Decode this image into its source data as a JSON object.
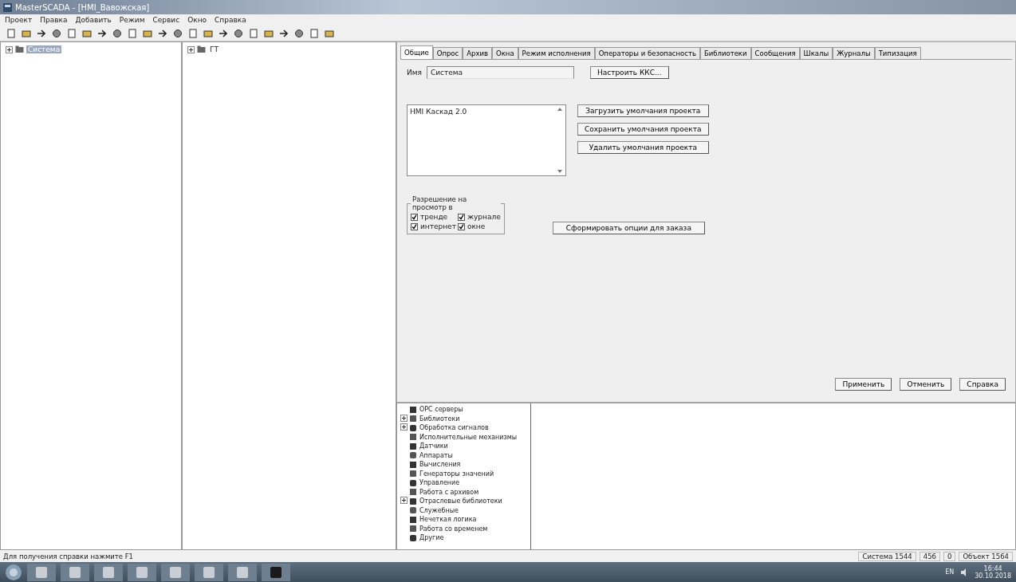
{
  "window": {
    "title": "MasterSCADA - [HMI_Вавожская]"
  },
  "menu": [
    "Проект",
    "Правка",
    "Добавить",
    "Режим",
    "Сервис",
    "Окно",
    "Справка"
  ],
  "system_tree": [
    {
      "label": "Система",
      "selected": true,
      "expanded": false
    }
  ],
  "object_tree": [
    {
      "label": "ГТ",
      "selected": false,
      "expanded": false
    }
  ],
  "tabs": [
    {
      "label": "Общие",
      "selected": true
    },
    {
      "label": "Опрос",
      "selected": false
    },
    {
      "label": "Архив",
      "selected": false
    },
    {
      "label": "Окна",
      "selected": false
    },
    {
      "label": "Режим исполнения",
      "selected": false
    },
    {
      "label": "Операторы и безопасность",
      "selected": false
    },
    {
      "label": "Библиотеки",
      "selected": false
    },
    {
      "label": "Сообщения",
      "selected": false
    },
    {
      "label": "Шкалы",
      "selected": false
    },
    {
      "label": "Журналы",
      "selected": false
    },
    {
      "label": "Типизация",
      "selected": false
    }
  ],
  "general": {
    "name_label": "Имя",
    "name_value": "Система",
    "kks_button": "Настроить ККС...",
    "description": "HMI Каскад 2.0",
    "default_buttons": [
      "Загрузить умолчания проекта",
      "Сохранить умолчания проекта",
      "Удалить умолчания проекта"
    ],
    "view_group": {
      "title": "Разрешение на просмотр в",
      "options": [
        {
          "label": "тренде",
          "checked": true
        },
        {
          "label": "журнале",
          "checked": true
        },
        {
          "label": "интернет",
          "checked": true
        },
        {
          "label": "окне",
          "checked": true
        }
      ]
    },
    "order_button": "Сформировать опции для заказа"
  },
  "dialog_buttons": [
    "Применить",
    "Отменить",
    "Справка"
  ],
  "library_tree": [
    {
      "label": "OPC серверы",
      "expandable": false
    },
    {
      "label": "Библиотеки",
      "expandable": true
    },
    {
      "label": "Обработка сигналов",
      "expandable": true
    },
    {
      "label": "Исполнительные механизмы",
      "expandable": false
    },
    {
      "label": "Датчики",
      "expandable": false
    },
    {
      "label": "Аппараты",
      "expandable": false
    },
    {
      "label": "Вычисления",
      "expandable": false
    },
    {
      "label": "Генераторы значений",
      "expandable": false
    },
    {
      "label": "Управление",
      "expandable": false
    },
    {
      "label": "Работа с архивом",
      "expandable": false
    },
    {
      "label": "Отраслевые библиотеки",
      "expandable": true
    },
    {
      "label": "Служебные",
      "expandable": false
    },
    {
      "label": "Нечеткая логика",
      "expandable": false
    },
    {
      "label": "Работа со временем",
      "expandable": false
    },
    {
      "label": "Другие",
      "expandable": false
    }
  ],
  "status_bar": {
    "hint": "Для получения справки нажмите F1",
    "cells": [
      "Система 1544",
      "456",
      "0",
      "Объект 1564"
    ]
  },
  "taskbar": {
    "language": "EN",
    "time": "16:44",
    "date": "30.10.2018"
  }
}
